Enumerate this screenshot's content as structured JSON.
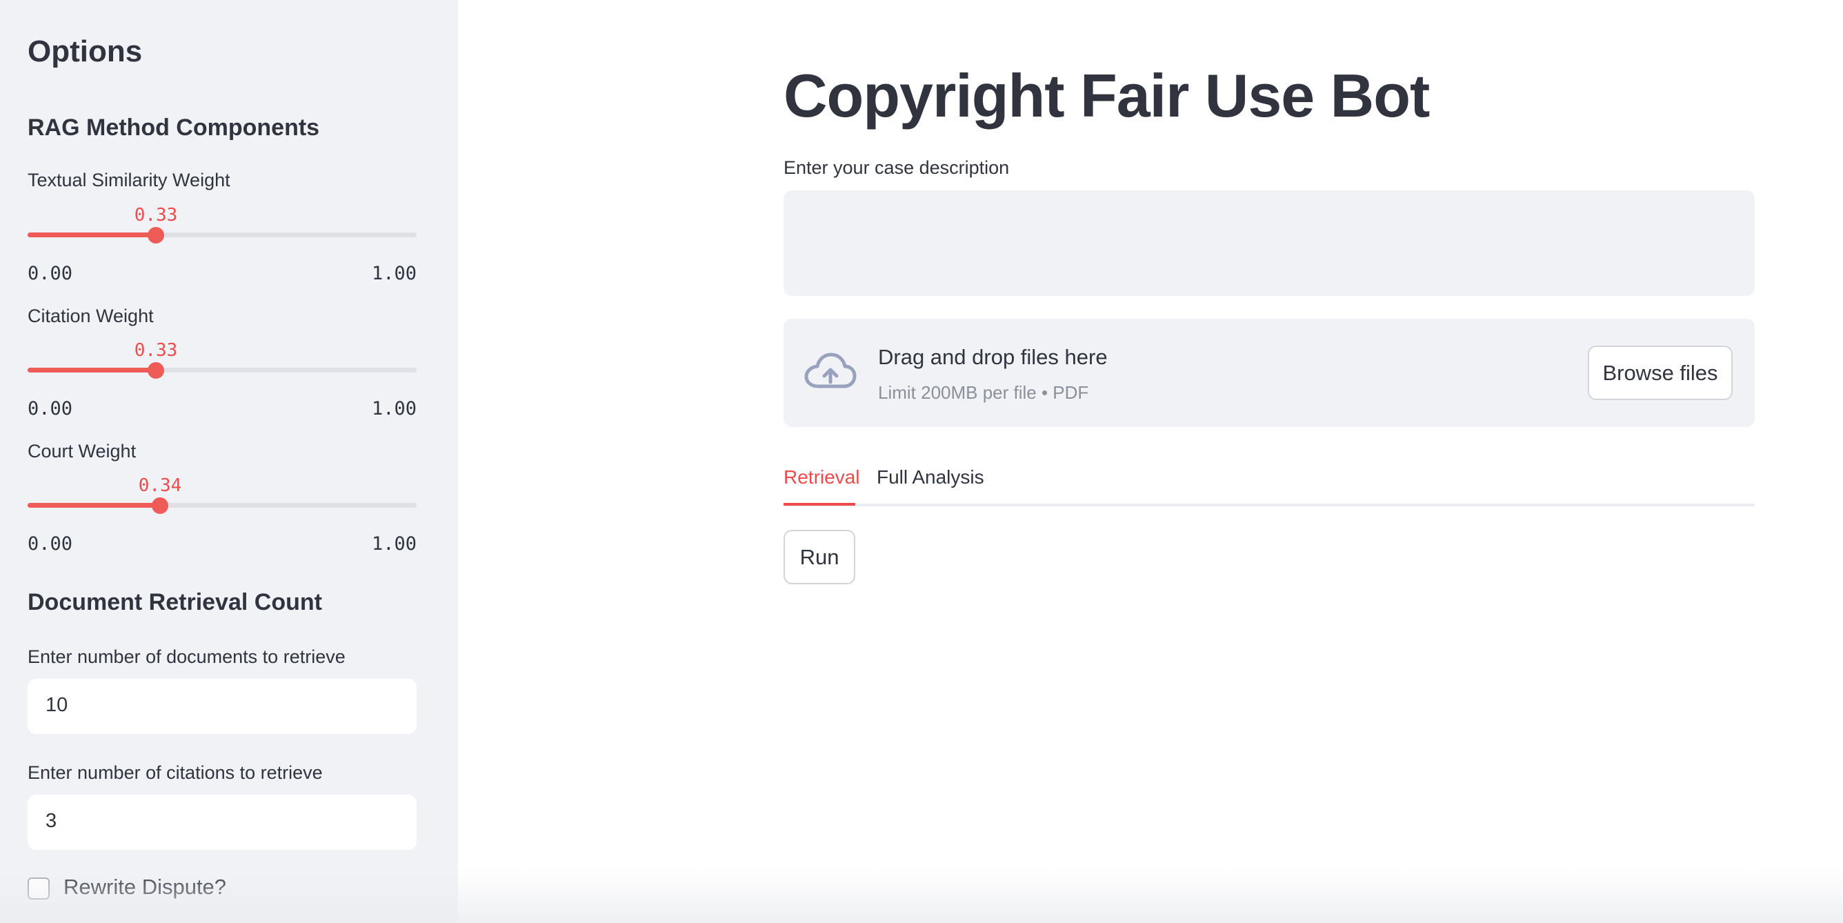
{
  "sidebar": {
    "title": "Options",
    "rag_heading": "RAG Method Components",
    "sliders": [
      {
        "label": "Textual Similarity Weight",
        "value": "0.33",
        "fraction": 0.33,
        "min": "0.00",
        "max": "1.00"
      },
      {
        "label": "Citation Weight",
        "value": "0.33",
        "fraction": 0.33,
        "min": "0.00",
        "max": "1.00"
      },
      {
        "label": "Court Weight",
        "value": "0.34",
        "fraction": 0.34,
        "min": "0.00",
        "max": "1.00"
      }
    ],
    "retrieval_heading": "Document Retrieval Count",
    "documents_label": "Enter number of documents to retrieve",
    "documents_value": "10",
    "citations_label": "Enter number of citations to retrieve",
    "citations_value": "3",
    "rewrite_label": "Rewrite Dispute?",
    "rewrite_checked": false
  },
  "main": {
    "title": "Copyright Fair Use Bot",
    "case_label": "Enter your case description",
    "case_value": "",
    "uploader": {
      "title": "Drag and drop files here",
      "subtitle": "Limit 200MB per file • PDF",
      "browse_label": "Browse files"
    },
    "tabs": [
      {
        "label": "Retrieval",
        "active": true
      },
      {
        "label": "Full Analysis",
        "active": false
      }
    ],
    "run_label": "Run"
  },
  "colors": {
    "accent": "#ef4b4b",
    "sidebar_bg": "#f0f2f6",
    "text": "#31333f"
  },
  "icons": {
    "upload": "cloud-upload-icon"
  }
}
